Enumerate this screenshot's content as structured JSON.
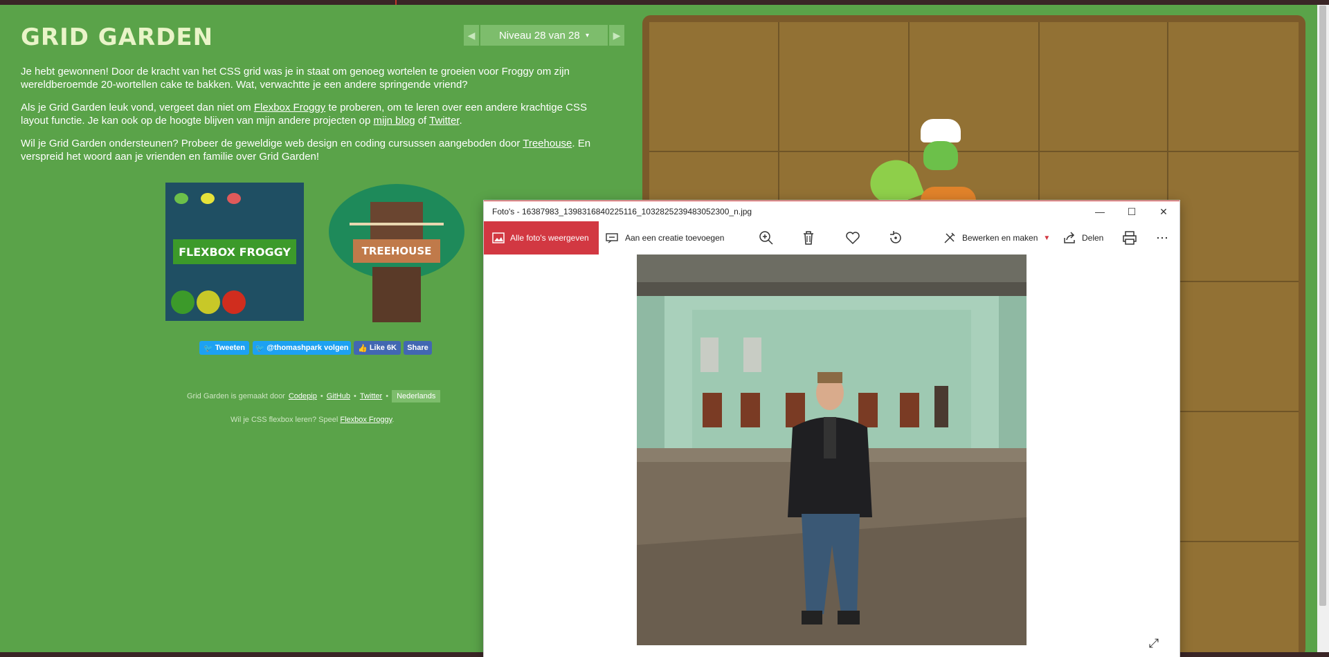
{
  "page": {
    "title": "GRID GARDEN",
    "paragraphs": {
      "p1": "Je hebt gewonnen! Door de kracht van het CSS grid was je in staat om genoeg wortelen te groeien voor Froggy om zijn wereldberoemde 20-wortellen cake te bakken. Wat, verwachtte je een andere springende vriend?",
      "p2_a": "Als je Grid Garden leuk vond, vergeet dan niet om ",
      "p2_link1": "Flexbox Froggy",
      "p2_b": " te proberen, om te leren over een andere krachtige CSS layout functie. Je kan ook op de hoogte blijven van mijn andere projecten op ",
      "p2_link2": "mijn blog",
      "p2_c": " of ",
      "p2_link3": "Twitter",
      "p2_d": ".",
      "p3_a": "Wil je Grid Garden ondersteunen? Probeer de geweldige web design en coding cursussen aangeboden door ",
      "p3_link": "Treehouse",
      "p3_b": ". En verspreid het woord aan je vrienden en familie over Grid Garden!"
    },
    "level_nav": {
      "prev": "◀",
      "label": "Niveau 28 van 28",
      "caret": "▾",
      "next": "▶"
    },
    "cards": {
      "froggy": "FLEXBOX FROGGY",
      "treehouse": "TREEHOUSE"
    },
    "social": {
      "tweet": "Tweeten",
      "follow": "@thomashpark volgen",
      "like": "Like 6K",
      "share": "Share"
    },
    "footer": {
      "made_by": "Grid Garden is gemaakt door",
      "link_codepip": "Codepip",
      "sep": "•",
      "link_github": "GitHub",
      "link_twitter": "Twitter",
      "language": "Nederlands",
      "flex_prompt": "Wil je CSS flexbox leren? Speel",
      "flex_link": "Flexbox Froggy",
      "flex_end": "."
    }
  },
  "photos_window": {
    "title": "Foto's - 16387983_1398316840225116_1032825239483052300_n.jpg",
    "controls": {
      "minimize": "—",
      "maximize": "☐",
      "close": "✕"
    },
    "toolbar": {
      "all_photos": "Alle foto's weergeven",
      "add_creation": "Aan een creatie toevoegen",
      "edit_create": "Bewerken en maken",
      "share": "Delen",
      "more": "⋯"
    }
  },
  "colors": {
    "page_bg": "#5aa349",
    "accent_red": "#d23842",
    "garden_soil": "#927134"
  }
}
